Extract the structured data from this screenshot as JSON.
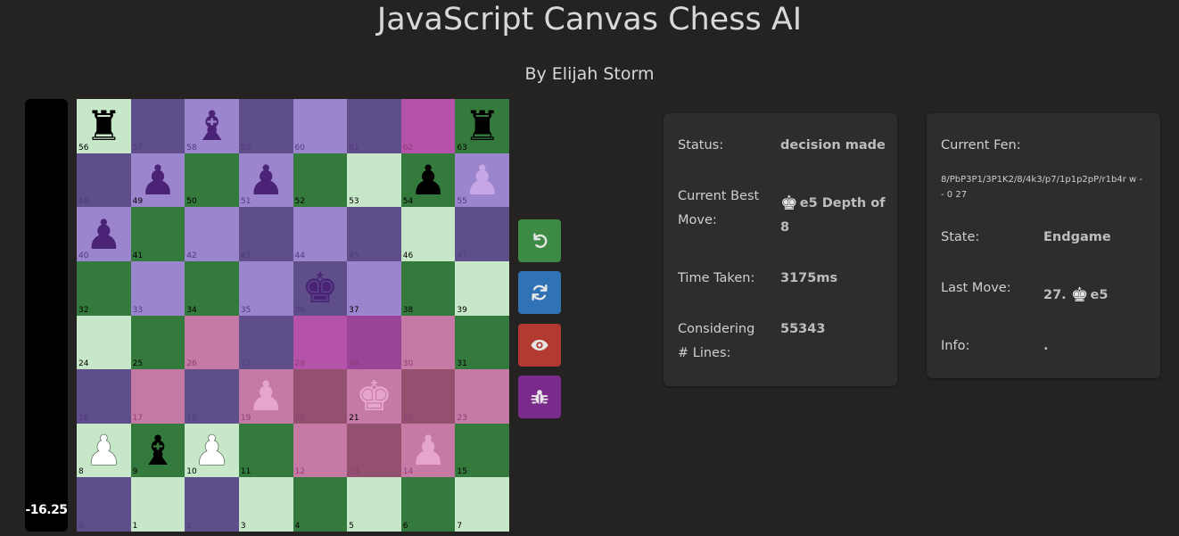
{
  "page": {
    "title": "JavaScript Canvas Chess AI",
    "subtitle": "By Elijah Storm"
  },
  "evaluation": {
    "value": "-16.25"
  },
  "board": {
    "colors": {
      "light": "#c6e7c8",
      "dark": "#357a3d",
      "purple_light": "#9b85cc",
      "purple_dark": "#5e4f8a",
      "magenta": "#b553aa",
      "magenta_dark": "#9a4497",
      "pink": "#c57aa6",
      "mauve": "#93506f",
      "piece_black": "#000000",
      "piece_white": "#ffffff",
      "piece_purple": "#4a2376",
      "piece_lilac": "#c8a7e6",
      "piece_pink": "#e6a5cf",
      "index_dark": "#000000",
      "index_purple": "#4f3a80",
      "index_pink": "#8e3d76"
    },
    "squares": [
      {
        "i": 56,
        "bg": "light",
        "piece": "rook",
        "pc": "piece_black",
        "ic": "index_dark"
      },
      {
        "i": 57,
        "bg": "purple_dark",
        "piece": null,
        "ic": "index_purple"
      },
      {
        "i": 58,
        "bg": "purple_light",
        "piece": "bishop",
        "pc": "piece_purple",
        "ic": "index_purple"
      },
      {
        "i": 59,
        "bg": "purple_dark",
        "piece": null,
        "ic": "index_purple"
      },
      {
        "i": 60,
        "bg": "purple_light",
        "piece": null,
        "ic": "index_purple"
      },
      {
        "i": 61,
        "bg": "purple_dark",
        "piece": null,
        "ic": "index_purple"
      },
      {
        "i": 62,
        "bg": "magenta",
        "piece": null,
        "ic": "index_pink"
      },
      {
        "i": 63,
        "bg": "dark",
        "piece": "rook",
        "pc": "piece_black",
        "ic": "index_dark"
      },
      {
        "i": 48,
        "bg": "purple_dark",
        "piece": null,
        "ic": "index_purple"
      },
      {
        "i": 49,
        "bg": "purple_light",
        "piece": "pawn",
        "pc": "piece_purple",
        "ic": "index_dark"
      },
      {
        "i": 50,
        "bg": "dark",
        "piece": null,
        "ic": "index_dark"
      },
      {
        "i": 51,
        "bg": "purple_light",
        "piece": "pawn",
        "pc": "piece_purple",
        "ic": "index_purple"
      },
      {
        "i": 52,
        "bg": "dark",
        "piece": null,
        "ic": "index_dark"
      },
      {
        "i": 53,
        "bg": "light",
        "piece": null,
        "ic": "index_dark"
      },
      {
        "i": 54,
        "bg": "dark",
        "piece": "pawn",
        "pc": "piece_black",
        "ic": "index_dark"
      },
      {
        "i": 55,
        "bg": "purple_light",
        "piece": "pawn",
        "pc": "piece_lilac",
        "ic": "index_purple"
      },
      {
        "i": 40,
        "bg": "purple_light",
        "piece": "pawn",
        "pc": "piece_purple",
        "ic": "index_purple"
      },
      {
        "i": 41,
        "bg": "dark",
        "piece": null,
        "ic": "index_dark"
      },
      {
        "i": 42,
        "bg": "purple_light",
        "piece": null,
        "ic": "index_purple"
      },
      {
        "i": 43,
        "bg": "purple_dark",
        "piece": null,
        "ic": "index_purple"
      },
      {
        "i": 44,
        "bg": "purple_light",
        "piece": null,
        "ic": "index_purple"
      },
      {
        "i": 45,
        "bg": "purple_dark",
        "piece": null,
        "ic": "index_purple"
      },
      {
        "i": 46,
        "bg": "light",
        "piece": null,
        "ic": "index_dark"
      },
      {
        "i": 47,
        "bg": "purple_dark",
        "piece": null,
        "ic": "index_purple"
      },
      {
        "i": 32,
        "bg": "dark",
        "piece": null,
        "ic": "index_dark"
      },
      {
        "i": 33,
        "bg": "purple_light",
        "piece": null,
        "ic": "index_purple"
      },
      {
        "i": 34,
        "bg": "dark",
        "piece": null,
        "ic": "index_dark"
      },
      {
        "i": 35,
        "bg": "purple_light",
        "piece": null,
        "ic": "index_purple"
      },
      {
        "i": 36,
        "bg": "purple_dark",
        "piece": "king",
        "pc": "piece_purple",
        "ic": "index_purple"
      },
      {
        "i": 37,
        "bg": "purple_light",
        "piece": null,
        "ic": "index_dark"
      },
      {
        "i": 38,
        "bg": "dark",
        "piece": null,
        "ic": "index_dark"
      },
      {
        "i": 39,
        "bg": "light",
        "piece": null,
        "ic": "index_dark"
      },
      {
        "i": 24,
        "bg": "light",
        "piece": null,
        "ic": "index_dark"
      },
      {
        "i": 25,
        "bg": "dark",
        "piece": null,
        "ic": "index_dark"
      },
      {
        "i": 26,
        "bg": "pink",
        "piece": null,
        "ic": "index_pink"
      },
      {
        "i": 27,
        "bg": "purple_dark",
        "piece": null,
        "ic": "index_purple"
      },
      {
        "i": 28,
        "bg": "magenta",
        "piece": null,
        "ic": "index_pink"
      },
      {
        "i": 29,
        "bg": "magenta_dark",
        "piece": null,
        "ic": "index_pink"
      },
      {
        "i": 30,
        "bg": "pink",
        "piece": null,
        "ic": "index_pink"
      },
      {
        "i": 31,
        "bg": "dark",
        "piece": null,
        "ic": "index_dark"
      },
      {
        "i": 16,
        "bg": "purple_dark",
        "piece": null,
        "ic": "index_purple"
      },
      {
        "i": 17,
        "bg": "pink",
        "piece": null,
        "ic": "index_pink"
      },
      {
        "i": 18,
        "bg": "purple_dark",
        "piece": null,
        "ic": "index_purple"
      },
      {
        "i": 19,
        "bg": "pink",
        "piece": "pawn",
        "pc": "piece_pink",
        "ic": "index_pink"
      },
      {
        "i": 20,
        "bg": "mauve",
        "piece": null,
        "ic": "index_pink"
      },
      {
        "i": 21,
        "bg": "pink",
        "piece": "king",
        "pc": "piece_pink",
        "ic": "index_dark"
      },
      {
        "i": 22,
        "bg": "mauve",
        "piece": null,
        "ic": "index_pink"
      },
      {
        "i": 23,
        "bg": "pink",
        "piece": null,
        "ic": "index_pink"
      },
      {
        "i": 8,
        "bg": "light",
        "piece": "pawn",
        "pc": "piece_white",
        "ic": "index_dark"
      },
      {
        "i": 9,
        "bg": "dark",
        "piece": "bishop",
        "pc": "piece_black",
        "ic": "index_dark"
      },
      {
        "i": 10,
        "bg": "light",
        "piece": "pawn",
        "pc": "piece_white",
        "ic": "index_dark"
      },
      {
        "i": 11,
        "bg": "dark",
        "piece": null,
        "ic": "index_dark"
      },
      {
        "i": 12,
        "bg": "pink",
        "piece": null,
        "ic": "index_pink"
      },
      {
        "i": 13,
        "bg": "mauve",
        "piece": null,
        "ic": "index_pink"
      },
      {
        "i": 14,
        "bg": "pink",
        "piece": "pawn",
        "pc": "piece_pink",
        "ic": "index_pink"
      },
      {
        "i": 15,
        "bg": "dark",
        "piece": null,
        "ic": "index_dark"
      },
      {
        "i": 0,
        "bg": "purple_dark",
        "piece": null,
        "ic": "index_purple"
      },
      {
        "i": 1,
        "bg": "light",
        "piece": null,
        "ic": "index_dark"
      },
      {
        "i": 2,
        "bg": "purple_dark",
        "piece": null,
        "ic": "index_purple"
      },
      {
        "i": 3,
        "bg": "light",
        "piece": null,
        "ic": "index_dark"
      },
      {
        "i": 4,
        "bg": "dark",
        "piece": null,
        "ic": "index_dark"
      },
      {
        "i": 5,
        "bg": "light",
        "piece": null,
        "ic": "index_dark"
      },
      {
        "i": 6,
        "bg": "dark",
        "piece": null,
        "ic": "index_dark"
      },
      {
        "i": 7,
        "bg": "light",
        "piece": null,
        "ic": "index_dark"
      }
    ]
  },
  "controls": [
    {
      "name": "undo-button",
      "icon": "undo-icon",
      "color": "#3d8a44"
    },
    {
      "name": "rotate-board-button",
      "icon": "sync-icon",
      "color": "#2f72b5"
    },
    {
      "name": "toggle-view-button",
      "icon": "eye-icon",
      "color": "#b23a31"
    },
    {
      "name": "debug-button",
      "icon": "bug-icon",
      "color": "#7a2a8a"
    }
  ],
  "status_panel": {
    "status_label": "Status:",
    "status_value": "decision made",
    "best_move_label": "Current Best Move:",
    "best_move_value": "e5 Depth of 8",
    "best_move_icon": "black-king-icon",
    "time_label": "Time Taken:",
    "time_value": "3175ms",
    "lines_label": "Considering # Lines:",
    "lines_value": "55343"
  },
  "info_panel": {
    "fen_label": "Current Fen:",
    "fen_value": "8/PbP3P1/3P1K2/8/4k3/p7/1p1p2pP/r1b4r w - - 0 27",
    "state_label": "State:",
    "state_value": "Endgame",
    "last_move_label": "Last Move:",
    "last_move_number": "27.",
    "last_move_square": "e5",
    "last_move_icon": "black-king-icon",
    "info_label": "Info:",
    "info_value": "."
  }
}
